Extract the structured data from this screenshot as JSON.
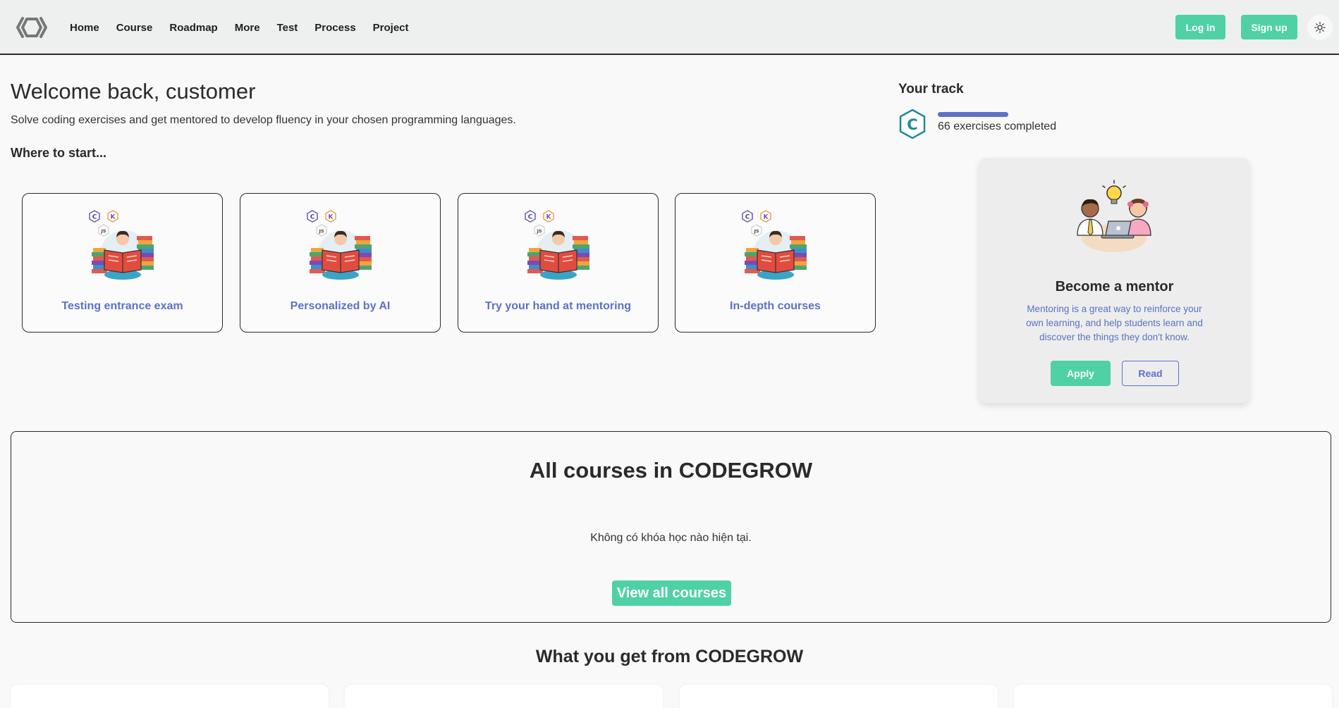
{
  "header": {
    "nav": [
      "Home",
      "Course",
      "Roadmap",
      "More",
      "Test",
      "Process",
      "Project"
    ],
    "login_label": "Log in",
    "signup_label": "Sign up",
    "theme_icon": "sun-icon"
  },
  "welcome": {
    "title": "Welcome back, customer",
    "subtitle": "Solve coding exercises and get mentored to develop fluency in your chosen programming languages.",
    "where_to_start": "Where to start..."
  },
  "start_cards": [
    {
      "label": "Testing entrance exam",
      "icon": "reading-student-illustration"
    },
    {
      "label": "Personalized by AI",
      "icon": "reading-student-illustration"
    },
    {
      "label": "Try your hand at mentoring",
      "icon": "reading-student-illustration"
    },
    {
      "label": "In-depth courses",
      "icon": "reading-student-illustration"
    }
  ],
  "track": {
    "title": "Your track",
    "icon_letter": "C",
    "progress_text": "66 exercises completed",
    "progress_fraction": 1.0
  },
  "mentor": {
    "title": "Become a mentor",
    "description": "Mentoring is a great way to reinforce your own learning, and help students learn and discover the things they don't know.",
    "apply_label": "Apply",
    "read_label": "Read"
  },
  "courses": {
    "title": "All courses in CODEGROW",
    "empty_text": "Không có khóa học nào hiện tại.",
    "view_all_label": "View all courses"
  },
  "benefits": {
    "title": "What you get from CODEGROW"
  },
  "colors": {
    "accent_green": "#4fd1a5",
    "accent_blue": "#5f71c7",
    "link_blue": "#5b72c5"
  }
}
